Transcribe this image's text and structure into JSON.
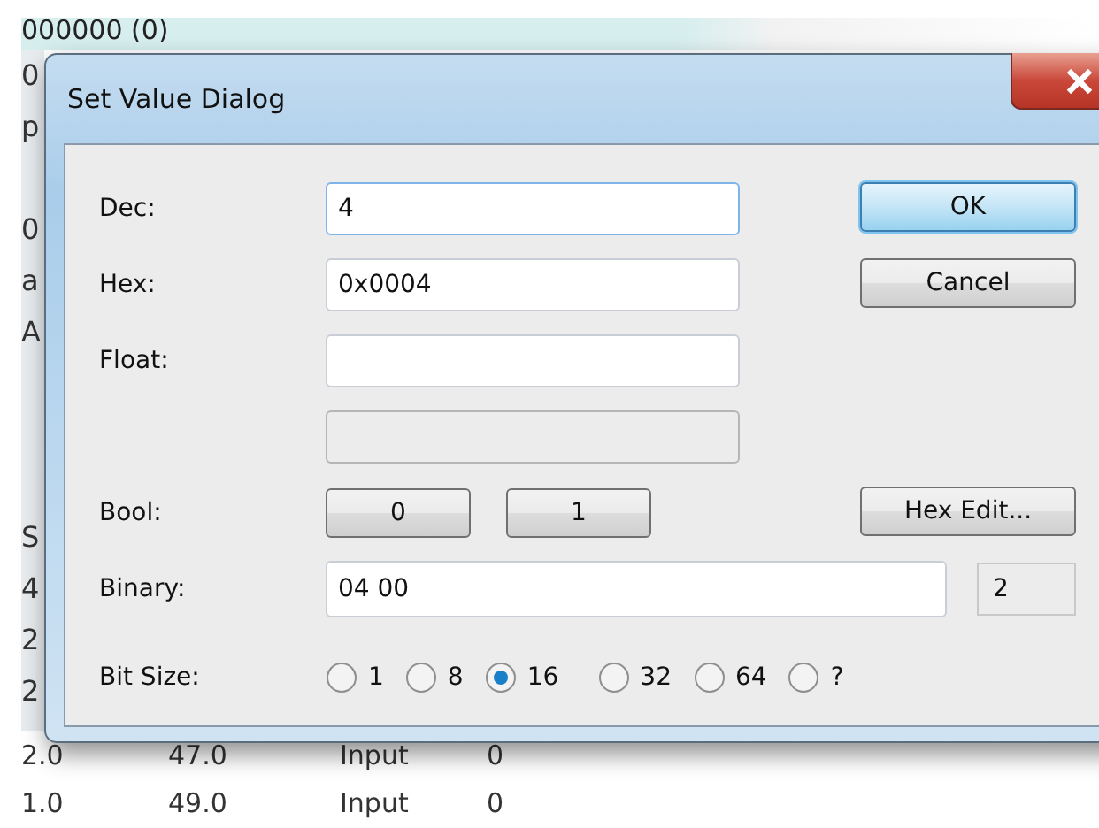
{
  "background_window": {
    "top_line": "000000 (0)",
    "left_column": [
      "0",
      "p",
      "0",
      "a",
      "A",
      "S",
      "4",
      "2",
      "2"
    ],
    "rows": [
      [
        "2.0",
        "47.0",
        "Input",
        "0"
      ],
      [
        "1.0",
        "49.0",
        "Input",
        "0"
      ]
    ]
  },
  "dialog": {
    "title": "Set Value Dialog",
    "fields": [
      {
        "kind": "text",
        "label": "Dec:",
        "value": "4",
        "focused": true
      },
      {
        "kind": "text",
        "label": "Hex:",
        "value": "0x0004",
        "focused": false
      },
      {
        "kind": "text",
        "label": "Float:",
        "focused": false
      },
      {
        "kind": "readonly",
        "focused": false
      }
    ],
    "bool": {
      "label": "Bool:",
      "buttons": [
        "0",
        "1"
      ]
    },
    "binary": {
      "label": "Binary:",
      "value": "04 00",
      "size": "2"
    },
    "bit_size": {
      "label": "Bit Size:",
      "options": [
        {
          "label": "1",
          "selected": false
        },
        {
          "label": "8",
          "selected": false
        },
        {
          "label": "16",
          "selected": true
        },
        {
          "label": "32",
          "selected": false
        },
        {
          "label": "64",
          "selected": false
        },
        {
          "label": "?",
          "selected": false
        }
      ]
    },
    "buttons": [
      {
        "label": "OK",
        "default": true
      },
      {
        "label": "Cancel",
        "default": false
      }
    ],
    "hex_edit": "Hex Edit..."
  }
}
